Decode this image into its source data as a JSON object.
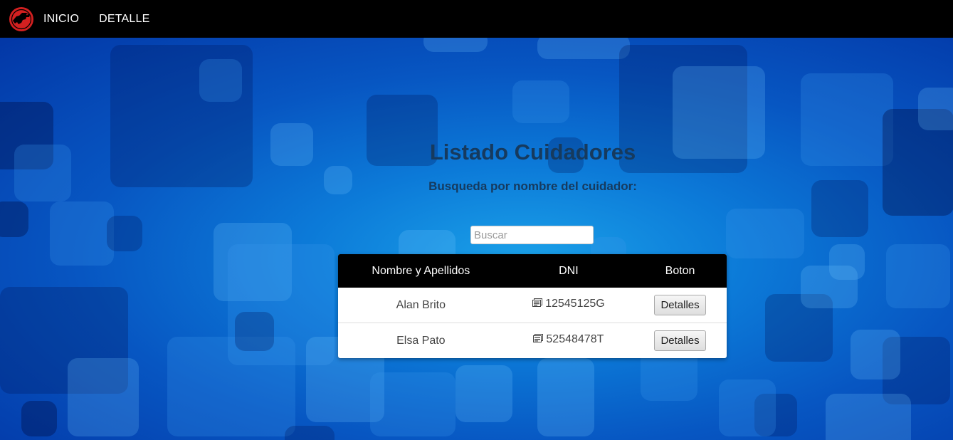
{
  "nav": {
    "logo_icon": "dinosaur-logo-icon",
    "links": [
      {
        "label": "INICIO"
      },
      {
        "label": "DETALLE"
      }
    ]
  },
  "page": {
    "title": "Listado Cuidadores",
    "subtitle": "Busqueda por nombre del cuidador:"
  },
  "search": {
    "value": "",
    "placeholder": "Buscar"
  },
  "table": {
    "headers": [
      "Nombre y Apellidos",
      "DNI",
      "Boton"
    ],
    "rows": [
      {
        "name": "Alan Brito",
        "dni_icon": "id-card-icon",
        "dni": "12545125G",
        "button": "Detalles"
      },
      {
        "name": "Elsa Pato",
        "dni_icon": "id-card-icon",
        "dni": "52548478T",
        "button": "Detalles"
      }
    ]
  },
  "colors": {
    "navbar": "#000000",
    "background": "#0a5cc8",
    "title": "#163a5e",
    "logo": "#d32020"
  }
}
